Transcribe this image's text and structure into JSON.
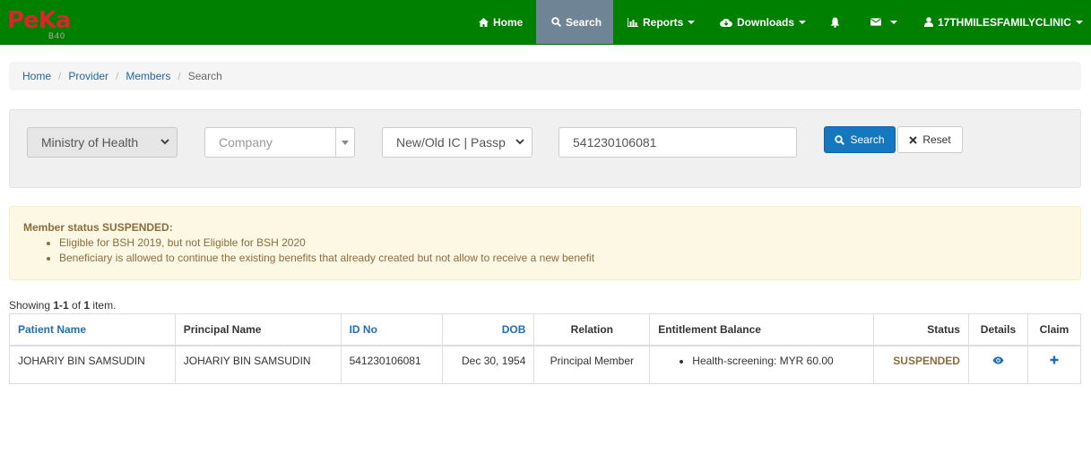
{
  "app": {
    "logo_text": "PeKa",
    "logo_sub": "B40"
  },
  "nav": {
    "home": "Home",
    "search": "Search",
    "reports": "Reports",
    "downloads": "Downloads",
    "user": "17THMILESFAMILYCLINIC"
  },
  "breadcrumb": {
    "items": [
      "Home",
      "Provider",
      "Members"
    ],
    "current": "Search"
  },
  "search": {
    "agency_value": "Ministry of Health",
    "company_placeholder": "Company",
    "id_type_value": "New/Old IC | Passp",
    "query_value": "541230106081",
    "search_label": "Search",
    "reset_label": "Reset"
  },
  "alert": {
    "heading": "Member status SUSPENDED:",
    "items": [
      "Eligible for BSH 2019, but not Eligible for BSH 2020",
      "Beneficiary is allowed to continue the existing benefits that already created but not allow to receive a new benefit"
    ]
  },
  "summary": {
    "prefix": "Showing ",
    "range": "1-1",
    "middle": " of ",
    "total": "1",
    "suffix": " item."
  },
  "table": {
    "headers": [
      "Patient Name",
      "Principal Name",
      "ID No",
      "DOB",
      "Relation",
      "Entitlement Balance",
      "Status",
      "Details",
      "Claim"
    ],
    "rows": [
      {
        "patient_name": "JOHARIY BIN SAMSUDIN",
        "principal_name": "JOHARIY BIN SAMSUDIN",
        "id_no": "541230106081",
        "dob": "Dec 30, 1954",
        "relation": "Principal Member",
        "entitlement": "Health-screening: MYR 60.00",
        "status": "SUSPENDED"
      }
    ]
  },
  "colors": {
    "navbar": "#008000",
    "nav_active": "#6f8596",
    "primary": "#1478bf",
    "warning_text": "#8a6d3b"
  },
  "icons": [
    "home-icon",
    "search-icon",
    "bar-chart-icon",
    "cloud-download-icon",
    "bell-icon",
    "envelope-icon",
    "user-icon",
    "remove-icon",
    "eye-icon",
    "plus-icon"
  ]
}
